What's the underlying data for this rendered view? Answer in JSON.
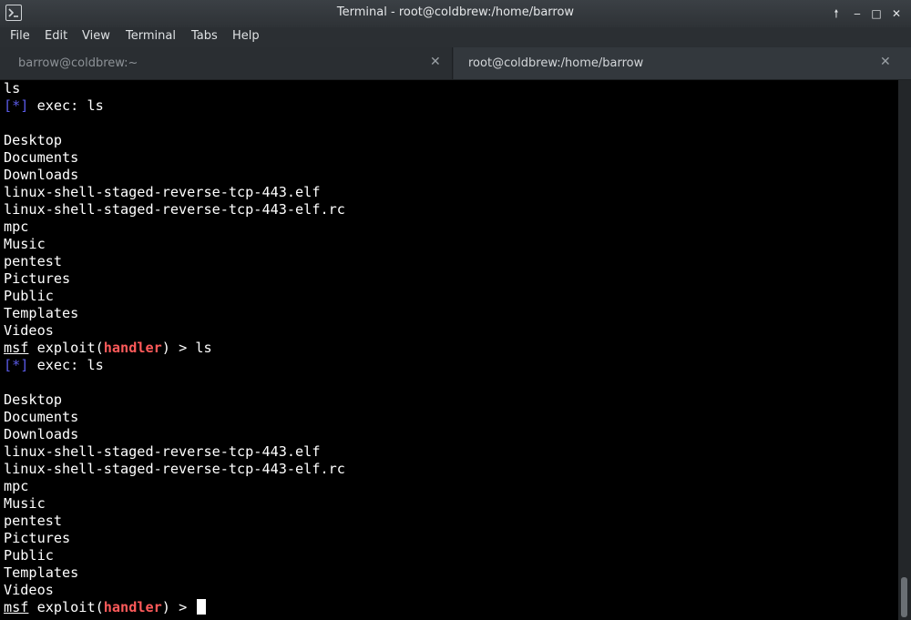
{
  "window": {
    "title": "Terminal - root@coldbrew:/home/barrow",
    "buttons": [
      {
        "name": "raise-button",
        "symbol": "🠕"
      },
      {
        "name": "minimize-button",
        "symbol": "‒"
      },
      {
        "name": "maximize-button",
        "symbol": "□"
      },
      {
        "name": "close-button",
        "symbol": "✕"
      }
    ]
  },
  "menu": [
    "File",
    "Edit",
    "View",
    "Terminal",
    "Tabs",
    "Help"
  ],
  "tabs": [
    {
      "label": "barrow@coldbrew:~",
      "active": false
    },
    {
      "label": "root@coldbrew:/home/barrow",
      "active": true
    }
  ],
  "terminal": {
    "colors": {
      "background": "#000000",
      "text": "#ffffff",
      "info": "#5a5ae6",
      "module": "#ff5a5a"
    },
    "prompt": {
      "prefix": "msf",
      "cmd": "exploit",
      "module": "handler",
      "suffix": "> "
    },
    "lines": [
      {
        "type": "text",
        "text": "ls"
      },
      {
        "type": "info",
        "tag": "[*]",
        "text": " exec: ls"
      },
      {
        "type": "text",
        "text": ""
      },
      {
        "type": "text",
        "text": "Desktop"
      },
      {
        "type": "text",
        "text": "Documents"
      },
      {
        "type": "text",
        "text": "Downloads"
      },
      {
        "type": "text",
        "text": "linux-shell-staged-reverse-tcp-443.elf"
      },
      {
        "type": "text",
        "text": "linux-shell-staged-reverse-tcp-443-elf.rc"
      },
      {
        "type": "text",
        "text": "mpc"
      },
      {
        "type": "text",
        "text": "Music"
      },
      {
        "type": "text",
        "text": "pentest"
      },
      {
        "type": "text",
        "text": "Pictures"
      },
      {
        "type": "text",
        "text": "Public"
      },
      {
        "type": "text",
        "text": "Templates"
      },
      {
        "type": "text",
        "text": "Videos"
      },
      {
        "type": "prompt",
        "input": "ls"
      },
      {
        "type": "info",
        "tag": "[*]",
        "text": " exec: ls"
      },
      {
        "type": "text",
        "text": ""
      },
      {
        "type": "text",
        "text": "Desktop"
      },
      {
        "type": "text",
        "text": "Documents"
      },
      {
        "type": "text",
        "text": "Downloads"
      },
      {
        "type": "text",
        "text": "linux-shell-staged-reverse-tcp-443.elf"
      },
      {
        "type": "text",
        "text": "linux-shell-staged-reverse-tcp-443-elf.rc"
      },
      {
        "type": "text",
        "text": "mpc"
      },
      {
        "type": "text",
        "text": "Music"
      },
      {
        "type": "text",
        "text": "pentest"
      },
      {
        "type": "text",
        "text": "Pictures"
      },
      {
        "type": "text",
        "text": "Public"
      },
      {
        "type": "text",
        "text": "Templates"
      },
      {
        "type": "text",
        "text": "Videos"
      },
      {
        "type": "prompt",
        "input": "",
        "cursor": true
      }
    ]
  }
}
